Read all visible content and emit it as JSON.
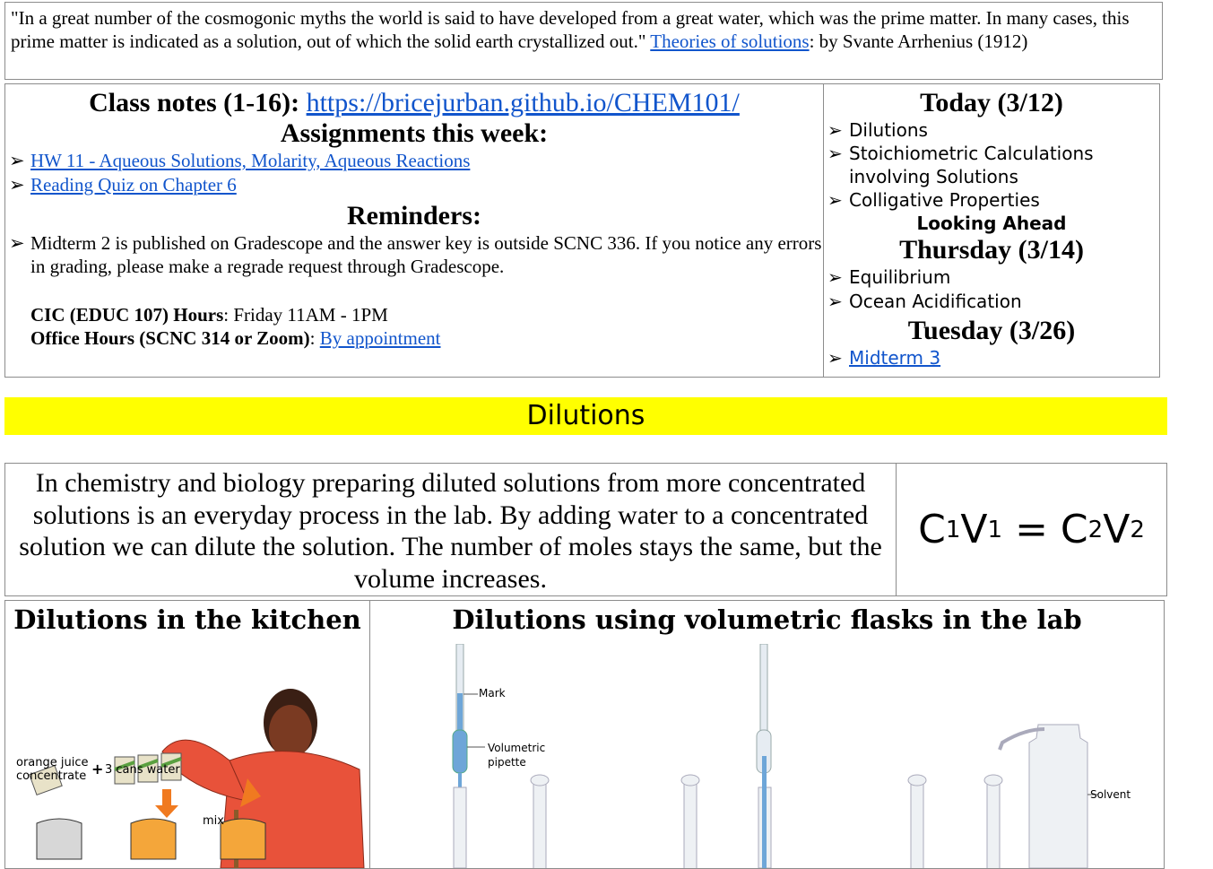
{
  "quote": {
    "text": "\"In a great number of the cosmogonic myths the world is said to have developed from a great water, which was the prime matter. In many cases, this prime matter is indicated as a solution, out of which the solid earth crystallized out.\" ",
    "link": "Theories of solutions",
    "tail": ": by Svante Arrhenius (1912)"
  },
  "class_notes": {
    "label": "Class notes (1-16): ",
    "url": "https://bricejurban.github.io/CHEM101/"
  },
  "assignments": {
    "heading": "Assignments this week:",
    "items": [
      "HW 11 - Aqueous Solutions, Molarity, Aqueous Reactions",
      "Reading Quiz on Chapter 6"
    ]
  },
  "reminders": {
    "heading": "Reminders:",
    "items": [
      "Midterm 2 is published on Gradescope and the answer key is outside SCNC 336. If you notice any errors in grading, please make a regrade request through Gradescope."
    ],
    "cic_label": "CIC (EDUC 107) Hours",
    "cic_value": ": Friday 11AM - 1PM",
    "office_label": "Office Hours (SCNC 314 or Zoom)",
    "office_sep": ": ",
    "office_link": "By appointment"
  },
  "today": {
    "heading": "Today (3/12)",
    "items": [
      "Dilutions",
      "Stoichiometric Calculations involving Solutions",
      "Colligative Properties"
    ]
  },
  "looking_ahead": "Looking Ahead",
  "thursday": {
    "heading": "Thursday (3/14)",
    "items": [
      "Equilibrium",
      "Ocean Acidification"
    ]
  },
  "tuesday": {
    "heading": "Tuesday (3/26)",
    "link": "Midterm 3"
  },
  "banner": "Dilutions",
  "intro": "In chemistry and biology preparing diluted solutions from more concentrated solutions is an everyday process in the lab. By adding water to a concentrated solution we can dilute the solution. The number of moles stays the same, but the volume increases.",
  "equation": {
    "c1": "C",
    "s1": "1",
    "v1": "V",
    "s2": "1",
    "eq": " = ",
    "c2": "C",
    "s3": "2",
    "v2": "V",
    "s4": "2"
  },
  "kitchen": {
    "title": "Dilutions in the kitchen",
    "labels": {
      "oj": "orange juice concentrate",
      "plus": "+",
      "cans": "3 cans water",
      "mix": "mix"
    }
  },
  "lab": {
    "title": "Dilutions using volumetric flasks in the lab",
    "labels": {
      "mark": "Mark",
      "pipette": "Volumetric pipette",
      "solvent": "Solvent"
    }
  },
  "bullet_glyph": "➢"
}
